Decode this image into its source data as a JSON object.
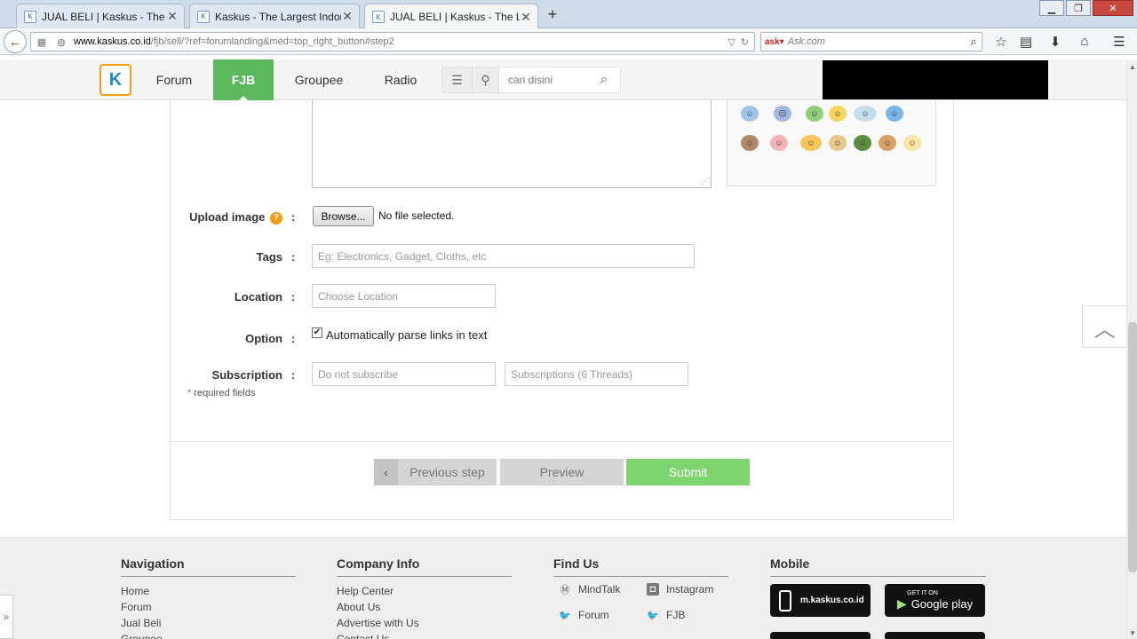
{
  "browser": {
    "tabs": [
      {
        "title": "JUAL BELI | Kaskus - The La..."
      },
      {
        "title": "Kaskus - The Largest Indon..."
      },
      {
        "title": "JUAL BELI | Kaskus - The La..."
      }
    ],
    "url_domain": "www.kaskus.co.id",
    "url_path": "/fjb/sell/?ref=forumlanding&med=top_right_button#step2",
    "search_engine": "Ask.com"
  },
  "header": {
    "nav": [
      "Forum",
      "FJB",
      "Groupee",
      "Radio"
    ],
    "search_placeholder": "cari disini"
  },
  "form": {
    "upload_label": "Upload image",
    "browse_label": "Browse...",
    "no_file": "No file selected.",
    "tags_label": "Tags",
    "tags_placeholder": "Eg: Electronics, Gadget, Cloths, etc",
    "location_label": "Location",
    "location_placeholder": "Choose Location",
    "option_label": "Option",
    "option_text": "Automatically parse links in text",
    "subscription_label": "Subscription",
    "subscription_value": "Do not subscribe",
    "subscriptions_value": "Subscriptions (6 Threads)",
    "required_note": "required fields",
    "colon": ":"
  },
  "buttons": {
    "previous": "Previous step",
    "preview": "Preview",
    "submit": "Submit"
  },
  "footer": {
    "navigation": {
      "title": "Navigation",
      "links": [
        "Home",
        "Forum",
        "Jual Beli",
        "Groupee"
      ]
    },
    "company": {
      "title": "Company Info",
      "links": [
        "Help Center",
        "About Us",
        "Advertise with Us",
        "Contact Us"
      ]
    },
    "find_us": {
      "title": "Find Us",
      "items": [
        "MindTalk",
        "Instagram",
        "Forum",
        "FJB"
      ]
    },
    "mobile": {
      "title": "Mobile",
      "mobile_site": "m.kaskus.co.id",
      "google_play_small": "GET IT ON",
      "google_play": "Google play"
    }
  },
  "colors": {
    "active_nav": "#5cb85c",
    "submit": "#7ed56f",
    "help_icon": "#f39c12"
  }
}
